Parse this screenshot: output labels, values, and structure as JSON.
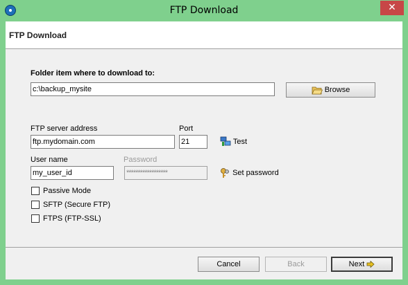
{
  "window": {
    "title": "FTP Download",
    "close_glyph": "✕"
  },
  "header": {
    "title": "FTP Download"
  },
  "form": {
    "folder_label": "Folder item where to download to:",
    "folder_value": "c:\\backup_mysite",
    "browse_label": "Browse",
    "server_label": "FTP server address",
    "server_value": "ftp.mydomain.com",
    "port_label": "Port",
    "port_value": "21",
    "test_label": "Test",
    "username_label": "User name",
    "username_value": "my_user_id",
    "password_label": "Password",
    "password_value": "******************",
    "set_password_label": "Set password",
    "passive_label": "Passive Mode",
    "sftp_label": "SFTP (Secure FTP)",
    "ftps_label": "FTPS (FTP-SSL)"
  },
  "footer": {
    "cancel_label": "Cancel",
    "back_label": "Back",
    "next_label": "Next"
  },
  "icons": {
    "app": "ftp-app-icon",
    "browse": "folder-open-icon",
    "test": "network-computers-icon",
    "set_password": "keys-icon",
    "next": "arrow-right-icon"
  },
  "colors": {
    "titlebar": "#7fd08d",
    "close_button": "#c74747",
    "client_bg": "#f0f0f0"
  }
}
